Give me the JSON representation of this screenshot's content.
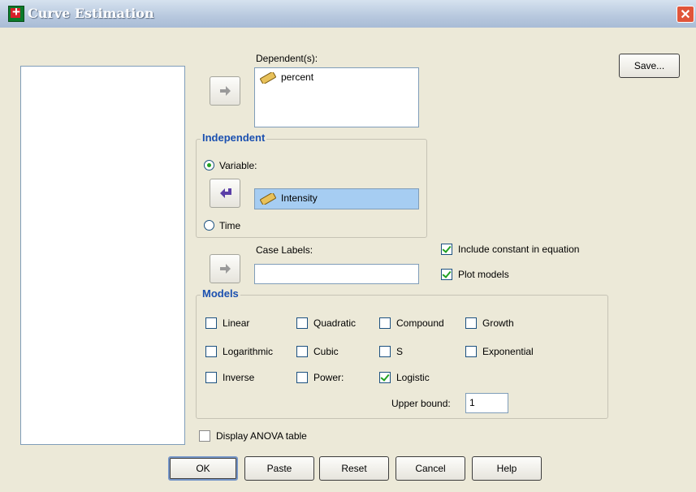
{
  "window": {
    "title": "Curve Estimation",
    "close_glyph": "✕"
  },
  "dependents": {
    "label": "Dependent(s):",
    "items": [
      "percent"
    ]
  },
  "independent": {
    "title": "Independent",
    "variable_label": "Variable:",
    "variable_value": "Intensity",
    "time_label": "Time",
    "selected": "variable"
  },
  "case_labels": {
    "label": "Case Labels:",
    "value": ""
  },
  "options": {
    "include_constant": {
      "label": "Include constant in equation",
      "checked": true
    },
    "plot_models": {
      "label": "Plot models",
      "checked": true
    },
    "display_anova": {
      "label": "Display ANOVA table",
      "checked": false
    }
  },
  "models": {
    "title": "Models",
    "items": [
      {
        "label": "Linear",
        "checked": false
      },
      {
        "label": "Quadratic",
        "checked": false
      },
      {
        "label": "Compound",
        "checked": false
      },
      {
        "label": "Growth",
        "checked": false
      },
      {
        "label": "Logarithmic",
        "checked": false
      },
      {
        "label": "Cubic",
        "checked": false
      },
      {
        "label": "S",
        "checked": false
      },
      {
        "label": "Exponential",
        "checked": false
      },
      {
        "label": "Inverse",
        "checked": false
      },
      {
        "label": "Power:",
        "checked": false
      },
      {
        "label": "Logistic",
        "checked": true
      }
    ],
    "upper_bound_label": "Upper bound:",
    "upper_bound_value": "1"
  },
  "buttons": {
    "save": "Save...",
    "ok": "OK",
    "paste": "Paste",
    "reset": "Reset",
    "cancel": "Cancel",
    "help": "Help"
  },
  "icons": {
    "arrow": "arrow-right-icon",
    "ruler": "scale-variable-icon"
  },
  "colors": {
    "accent": "#1b50b0",
    "check": "#21a121",
    "selection": "#a6cdf2"
  }
}
